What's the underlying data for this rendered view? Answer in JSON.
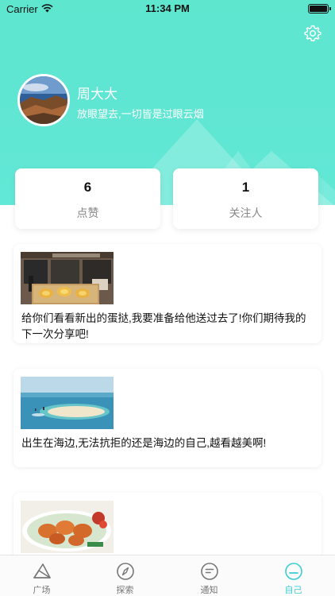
{
  "status_bar": {
    "carrier": "Carrier",
    "time": "11:34 PM"
  },
  "profile": {
    "name": "周大大",
    "signature": "放眼望去,一切皆是过眼云烟"
  },
  "stats": [
    {
      "value": "6",
      "label": "点赞"
    },
    {
      "value": "1",
      "label": "关注人"
    }
  ],
  "posts": [
    {
      "text": "给你们看看新出的蛋挞,我要准备给他送过去了!你们期待我的下一次分享吧!",
      "image": "bakery-photo"
    },
    {
      "text": "出生在海边,无法抗拒的还是海边的自己,越看越美啊!",
      "image": "beach-photo"
    },
    {
      "text": "",
      "image": "food-plate-photo"
    }
  ],
  "tabbar": {
    "items": [
      {
        "label": "广场",
        "icon": "square-plaza-icon",
        "active": false
      },
      {
        "label": "探索",
        "icon": "compass-icon",
        "active": false
      },
      {
        "label": "通知",
        "icon": "notice-icon",
        "active": false
      },
      {
        "label": "自己",
        "icon": "profile-face-icon",
        "active": true
      }
    ]
  },
  "colors": {
    "header": "#5fe6d2",
    "accent": "#3bcdd3",
    "card": "#ffffff"
  }
}
